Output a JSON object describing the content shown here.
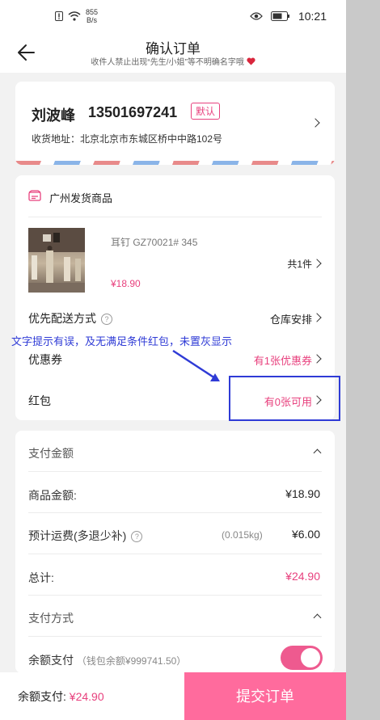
{
  "status_bar": {
    "net_speed_value": "855",
    "net_speed_unit": "B/s",
    "time": "10:21"
  },
  "header": {
    "title": "确认订单",
    "subtitle": "收件人禁止出现“先生/小姐”等不明确名字哦",
    "back_icon": "back-arrow-icon",
    "heart_icon": "heart-icon"
  },
  "address": {
    "name": "刘波峰",
    "phone": "13501697241",
    "tag": "默认",
    "line": "收货地址：北京北京市东城区桥中中路102号"
  },
  "order": {
    "shop_name": "广州发货商品",
    "goods_name": "耳钉  GZ70021#  345",
    "goods_price": "¥18.90",
    "goods_count": "共1件",
    "delivery_label": "优先配送方式",
    "delivery_value": "仓库安排",
    "coupon_label": "优惠券",
    "coupon_value": "有1张优惠券",
    "redpacket_label": "红包",
    "redpacket_value": "有0张可用"
  },
  "payment": {
    "amount_header": "支付金额",
    "goods_amount_label": "商品金额:",
    "goods_amount_value": "¥18.90",
    "shipping_label": "预计运费(多退少补)",
    "shipping_weight": "(0.015kg)",
    "shipping_value": "¥6.00",
    "total_label": "总计:",
    "total_value": "¥24.90",
    "method_header": "支付方式",
    "balance_label": "余额支付",
    "balance_note": "（钱包余额¥999741.50）",
    "balance_toggle_on": true
  },
  "bottom_bar": {
    "balance_pay_label": "余额支付:",
    "balance_pay_value": "¥24.90",
    "submit_label": "提交订单"
  },
  "annotation": {
    "text": "文字提示有误，及无满足条件红包，未置灰显示"
  },
  "colors": {
    "accent": "#e8417e",
    "submit_bg": "#ff6b9d",
    "annotation": "#2f3bd6"
  }
}
